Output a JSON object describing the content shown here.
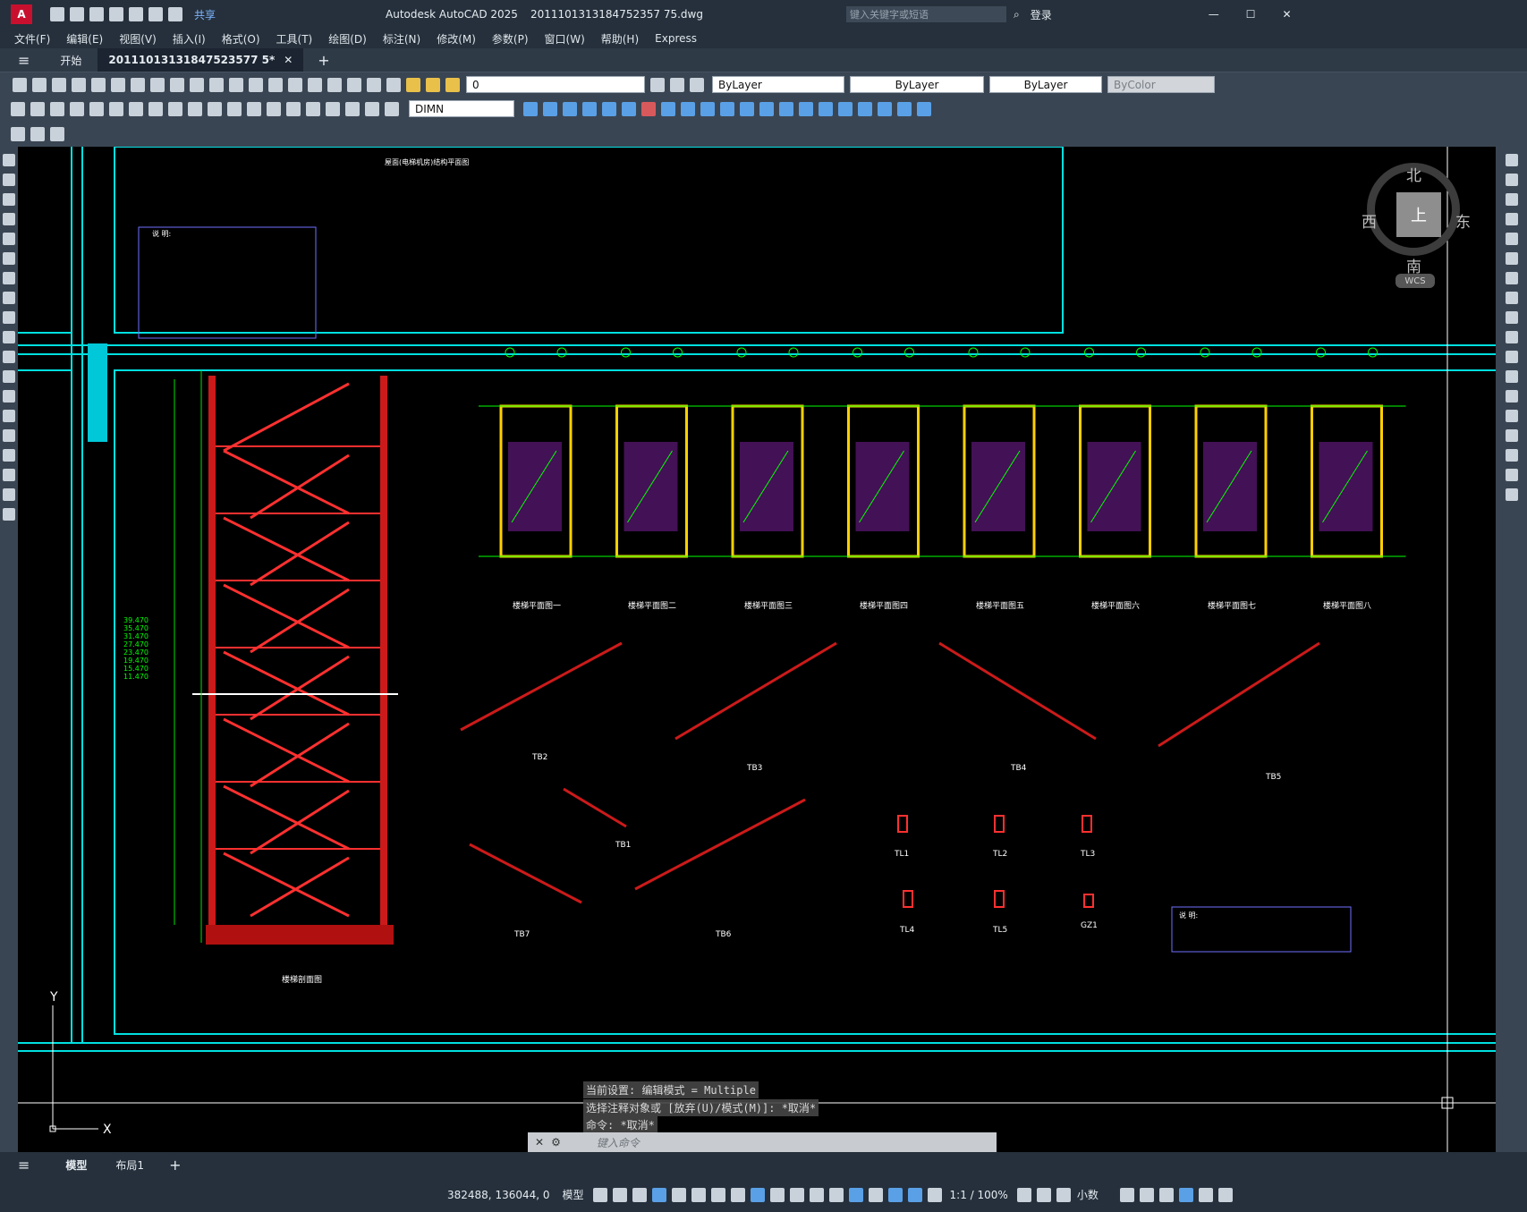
{
  "app": {
    "title": "Autodesk AutoCAD 2025",
    "filename": "2011101313184752357 75.dwg",
    "search_placeholder": "键入关键字或短语",
    "login": "登录",
    "share": "共享"
  },
  "menu": [
    "文件(F)",
    "编辑(E)",
    "视图(V)",
    "插入(I)",
    "格式(O)",
    "工具(T)",
    "绘图(D)",
    "标注(N)",
    "修改(M)",
    "参数(P)",
    "窗口(W)",
    "帮助(H)",
    "Express"
  ],
  "tabs": {
    "start": "开始",
    "document": "20111013131847523577 5*"
  },
  "toolbar": {
    "layer_value": "0",
    "color": "ByLayer",
    "linetype": "ByLayer",
    "lineweight": "ByLayer",
    "plotstyle": "ByColor",
    "dimstyle": "DIMN"
  },
  "viewcube": {
    "north": "北",
    "south": "南",
    "east": "东",
    "west": "西",
    "face": "上",
    "ucs": "WCS"
  },
  "drawing": {
    "elevations": [
      "39.470",
      "35.470",
      "31.470",
      "27.470",
      "23.470",
      "19.470",
      "15.470",
      "11.470"
    ],
    "section_title": "楼梯剖面图",
    "plan_titles": [
      "楼梯平面图一",
      "楼梯平面图二",
      "楼梯平面图三",
      "楼梯平面图四",
      "楼梯平面图五",
      "楼梯平面图六",
      "楼梯平面图七",
      "楼梯平面图八"
    ],
    "flight_labels": [
      "TB2",
      "TB3",
      "TB4",
      "TB5",
      "TB1",
      "TB7",
      "TB6"
    ],
    "beam_labels": [
      "TL1",
      "TL2",
      "TL3",
      "TL4",
      "TL5",
      "GZ1"
    ],
    "roof_plan_title": "屋面(电梯机房)结构平面图",
    "notes_title": "说 明:"
  },
  "command": {
    "line1": "当前设置: 编辑模式 = Multiple",
    "line2": "选择注释对象或 [放弃(U)/模式(M)]: *取消*",
    "line3": "命令: *取消*",
    "placeholder": "键入命令"
  },
  "layout_tabs": [
    "模型",
    "布局1"
  ],
  "status": {
    "coords": "382488, 136044, 0",
    "space": "模型",
    "scale": "1:1 / 100%",
    "units": "小数"
  }
}
